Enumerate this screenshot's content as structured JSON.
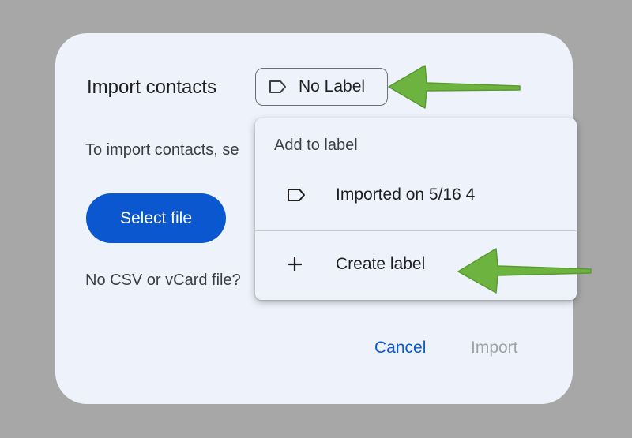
{
  "dialog": {
    "title": "Import contacts",
    "label_chip": {
      "text": "No Label",
      "icon": "label-outline-icon"
    },
    "instruction": "To import contacts, se",
    "select_file_label": "Select file",
    "no_file_text": "No CSV or vCard file?",
    "actions": {
      "cancel": "Cancel",
      "import": "Import"
    }
  },
  "label_menu": {
    "heading": "Add to label",
    "items": [
      {
        "icon": "label-outline-icon",
        "text": "Imported on 5/16 4"
      },
      {
        "icon": "plus-icon",
        "text": "Create label"
      }
    ]
  },
  "annotations": {
    "arrow_color": "#6db33f",
    "arrows": [
      "pointing-at-no-label-chip",
      "pointing-at-create-label"
    ]
  },
  "colors": {
    "background": "#a7a7a7",
    "dialog": "#eef2fa",
    "primary_button": "#0b57d0",
    "disabled_text": "#9ea1a6"
  }
}
